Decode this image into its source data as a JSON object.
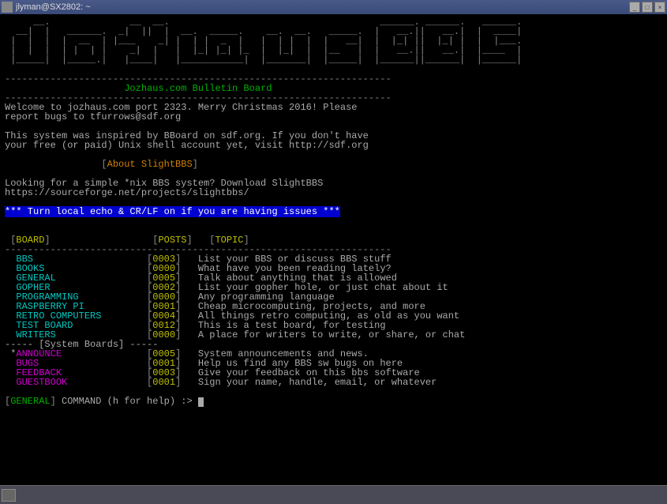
{
  "window": {
    "title": "jlyman@SX2802: ~"
  },
  "ascii_art": [
    "     __.              __  __.                                     ______. ______.   ______.",
    "  __|  |   ______.  _|  ||  |  __.  _____.    __.  __.   _____.  |   __.||   __.|  |  ____|",
    " |  |  |  |  __  | |___    _| |  | |  _  |   |  | |  |  |   __|  |  |_| ||  |_| |  |  |___.",
    " |  |  |  | |  | |    _|  |   |  |_| |_| |_  |  |_|  |  |__   |  |   __.||   __.|  |____  |",
    " |_____|  |_____.|   |____|   |___________|  |_______|  |_____|  |______||______|  |______|"
  ],
  "dash": "--------------------------------------------------------------------",
  "subtitle": "Jozhaus.com Bulletin Board",
  "welcome1": "Welcome to jozhaus.com port 2323. Merry Christmas 2016! Please",
  "welcome2": "report bugs to tfurrows@sdf.org",
  "inspired1": "This system was inspired by BBoard on sdf.org. If you don't have",
  "inspired2": "your free (or paid) Unix shell account yet, visit http://sdf.org",
  "about_label": "About SlightBBS",
  "looking1": "Looking for a simple *nix BBS system? Download SlightBBS",
  "looking2": "https://sourceforge.net/projects/slightbbs/",
  "echo_notice": "*** Turn local echo & CR/LF on if you are having issues ***",
  "headers": {
    "board": "BOARD",
    "posts": "POSTS",
    "topic": "TOPIC"
  },
  "boards": [
    {
      "name": "BBS",
      "posts": "0003",
      "topic": "List your BBS or discuss BBS stuff"
    },
    {
      "name": "BOOKS",
      "posts": "0000",
      "topic": "What have you been reading lately?"
    },
    {
      "name": "GENERAL",
      "posts": "0005",
      "topic": "Talk about anything that is allowed"
    },
    {
      "name": "GOPHER",
      "posts": "0002",
      "topic": "List your gopher hole, or just chat about it"
    },
    {
      "name": "PROGRAMMING",
      "posts": "0000",
      "topic": "Any programming language"
    },
    {
      "name": "RASPBERRY PI",
      "posts": "0001",
      "topic": "Cheap microcomputing, projects, and more"
    },
    {
      "name": "RETRO COMPUTERS",
      "posts": "0004",
      "topic": "All things retro computing, as old as you want"
    },
    {
      "name": "TEST BOARD",
      "posts": "0012",
      "topic": "This is a test board, for testing"
    },
    {
      "name": "WRITERS",
      "posts": "0000",
      "topic": "A place for writers to write, or share, or chat"
    }
  ],
  "system_boards_label": "----- [System Boards] -----",
  "system_boards": [
    {
      "star": true,
      "name": "ANNOUNCE",
      "posts": "0005",
      "topic": "System announcements and news."
    },
    {
      "star": false,
      "name": "BUGS",
      "posts": "0001",
      "topic": "Help us find any BBS sw bugs on here"
    },
    {
      "star": false,
      "name": "FEEDBACK",
      "posts": "0003",
      "topic": "Give your feedback on this bbs software"
    },
    {
      "star": false,
      "name": "GUESTBOOK",
      "posts": "0001",
      "topic": "Sign your name, handle, email, or whatever"
    }
  ],
  "prompt": {
    "board": "GENERAL",
    "text": " COMMAND (h for help) :> "
  }
}
